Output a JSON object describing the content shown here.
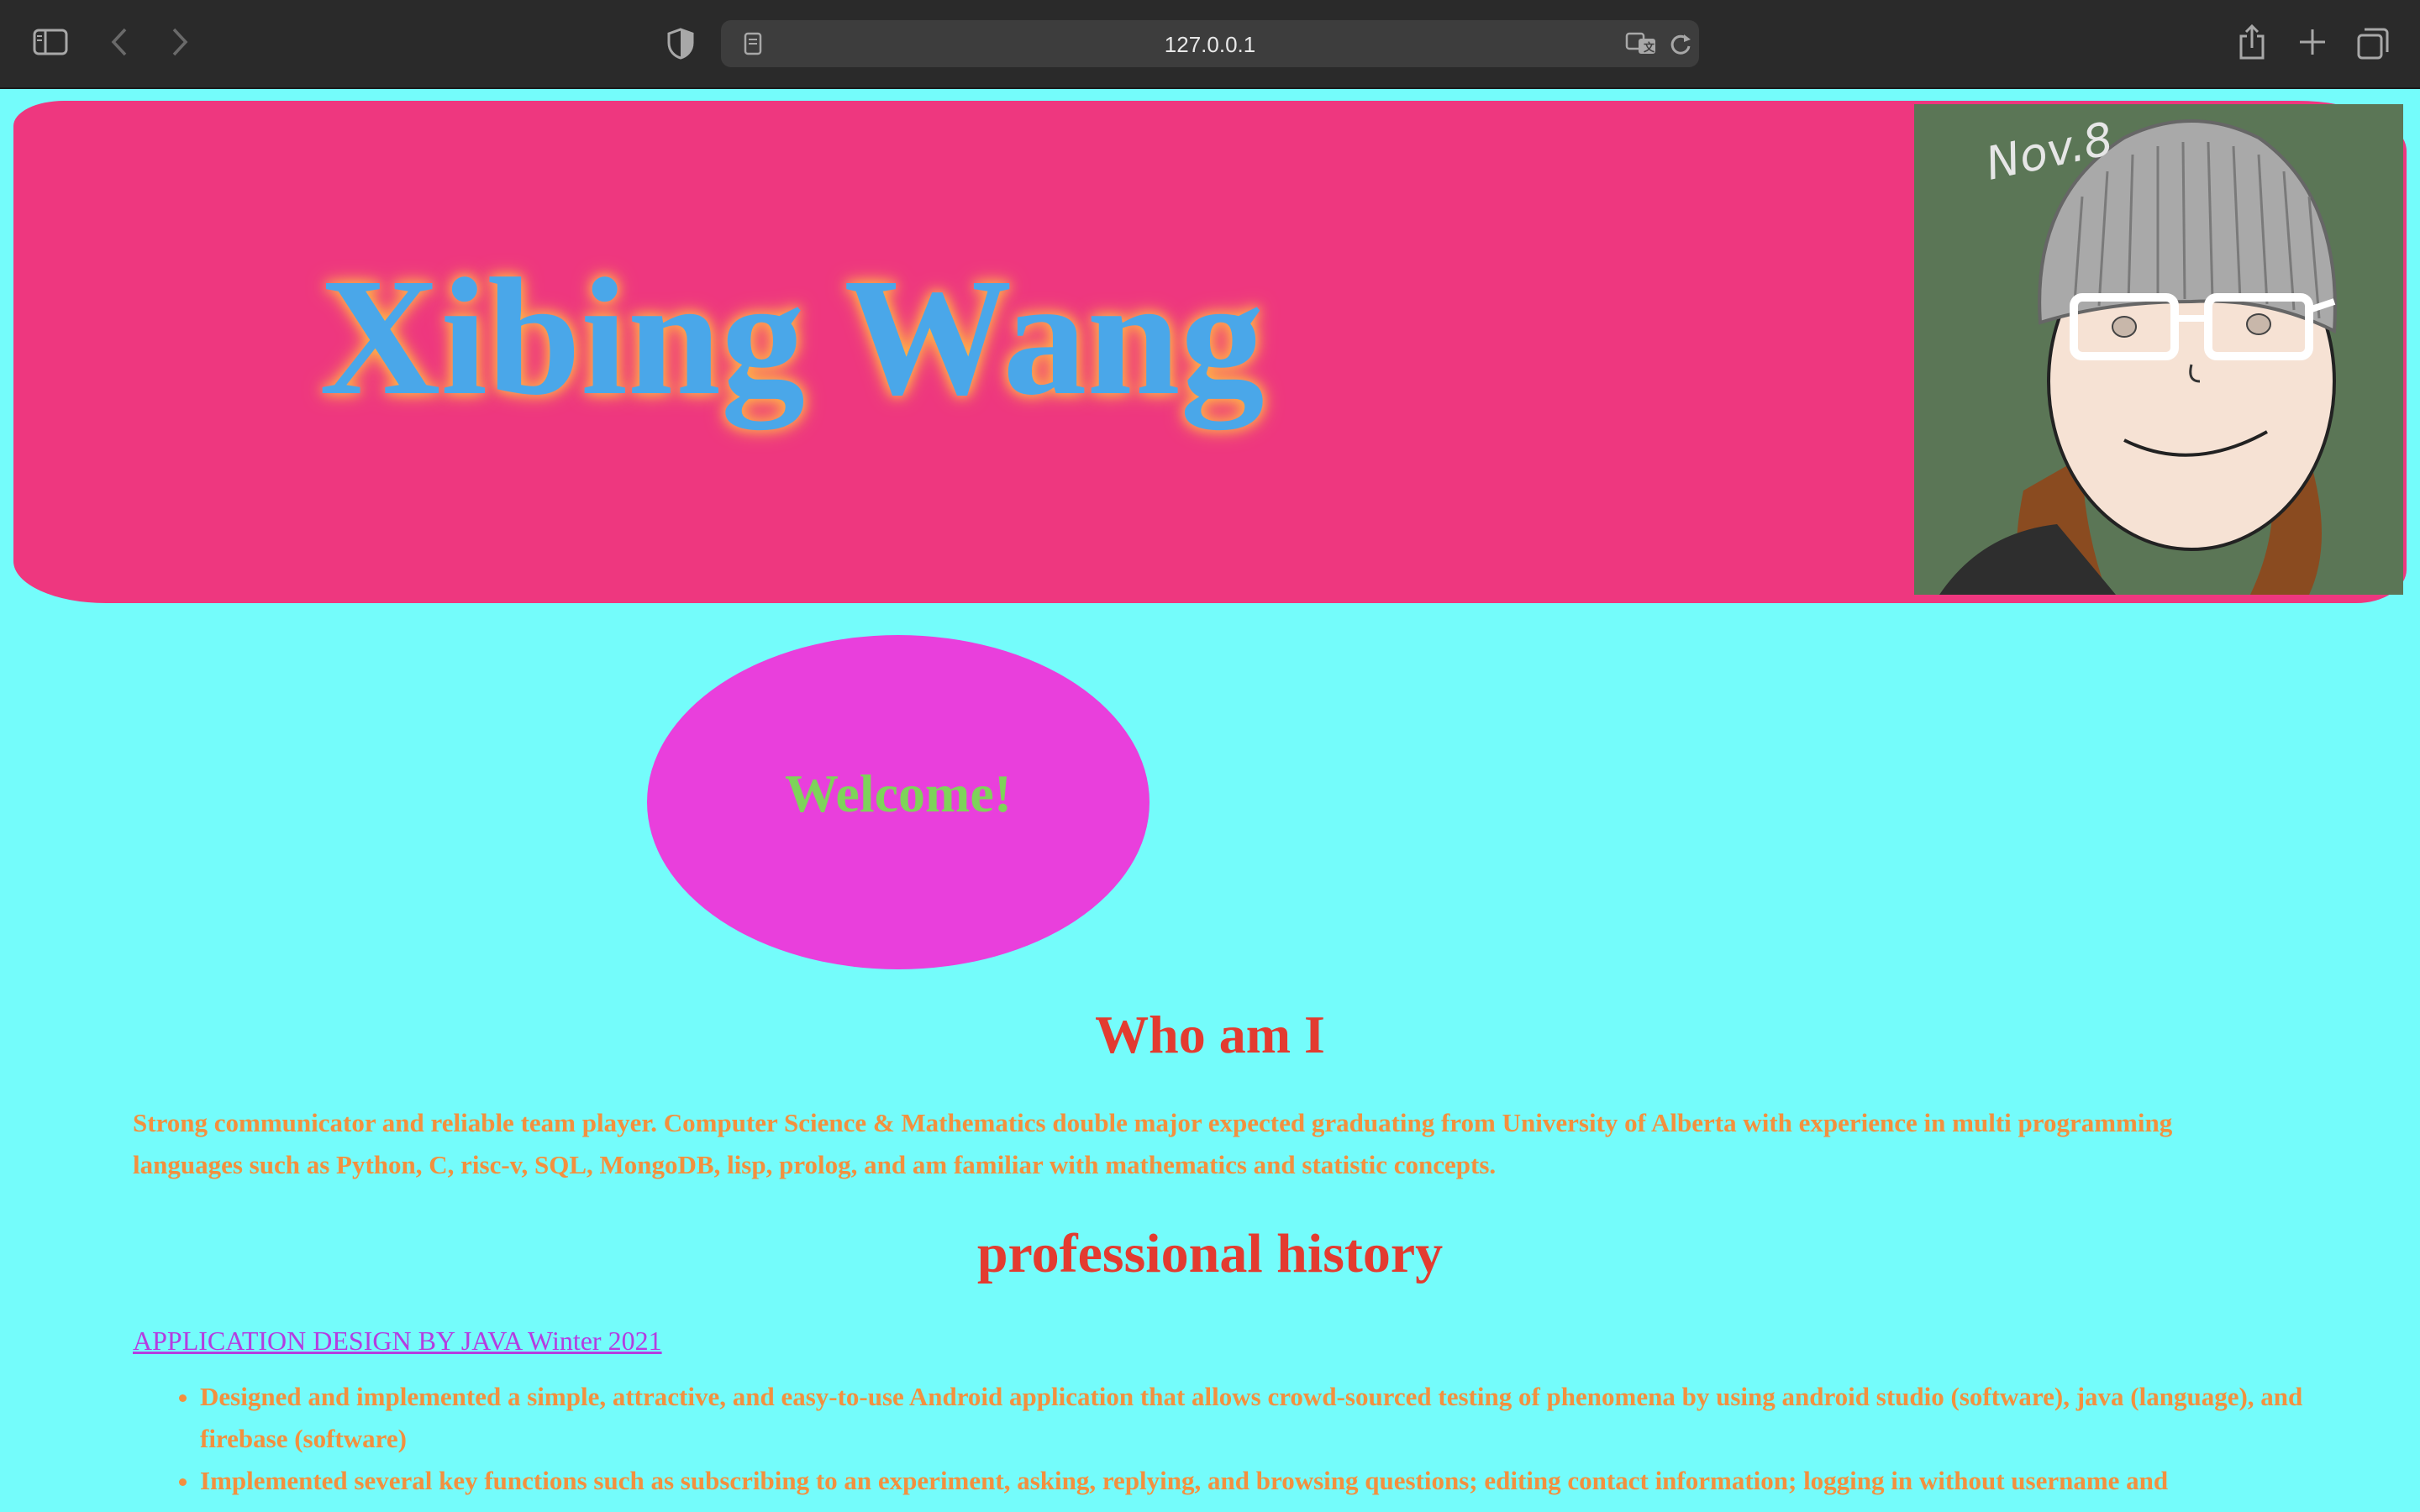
{
  "browser": {
    "url": "127.0.0.1"
  },
  "header": {
    "name": "Xibing Wang",
    "portrait_caption": "Nov.8"
  },
  "welcome": "Welcome!",
  "about": {
    "heading": "Who am I",
    "text": "Strong communicator and reliable team player. Computer Science & Mathematics double major expected graduating from University of Alberta with experience in multi programming languages such as Python, C, risc-v, SQL, MongoDB, lisp, prolog, and am familiar with mathematics and statistic concepts."
  },
  "history": {
    "heading": "professional history",
    "job_link": "APPLICATION DESIGN BY JAVA Winter 2021",
    "duties": [
      "Designed and implemented a simple, attractive, and easy-to-use Android application that allows crowd-sourced testing of phenomena by using android studio (software), java (language), and firebase (software)",
      "Implemented several key functions such as subscribing to an experiment, asking, replying, and browsing questions; editing contact information; logging in without username and"
    ]
  },
  "colors": {
    "page_bg": "#74fcfb",
    "banner": "#ee377f",
    "name": "#4aa7e9",
    "oval": "#e93fdc",
    "welcome": "#7ed35a",
    "heading": "#e33b30",
    "body_text": "#f3903e",
    "link": "#b43de0"
  }
}
